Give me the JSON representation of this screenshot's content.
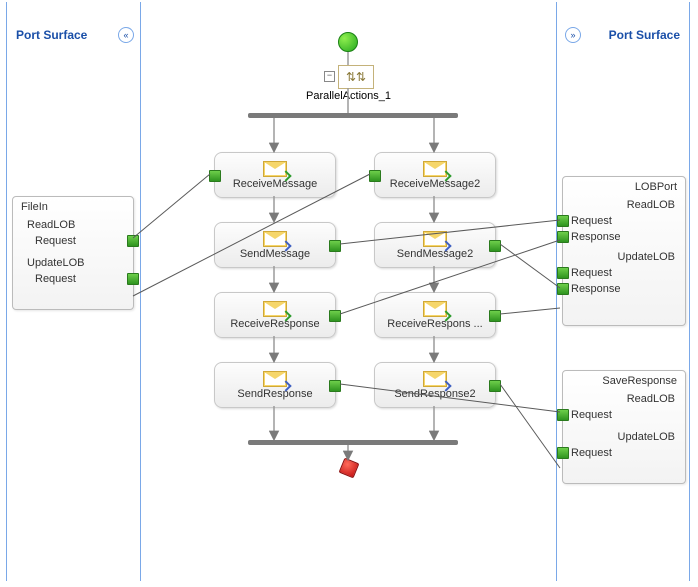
{
  "portSurface": {
    "leftLabel": "Port Surface",
    "rightLabel": "Port Surface"
  },
  "start": {
    "name": "start"
  },
  "end": {
    "name": "end"
  },
  "parallel": {
    "label": "ParallelActions_1",
    "expander": "−"
  },
  "actions": {
    "rm1": {
      "label": "ReceiveMessage",
      "kind": "receive"
    },
    "rm2": {
      "label": "ReceiveMessage2",
      "kind": "receive"
    },
    "sm1": {
      "label": "SendMessage",
      "kind": "send"
    },
    "sm2": {
      "label": "SendMessage2",
      "kind": "send"
    },
    "rr1": {
      "label": "ReceiveResponse",
      "kind": "receive"
    },
    "rr2": {
      "label": "ReceiveRespons ...",
      "kind": "receive"
    },
    "sr1": {
      "label": "SendResponse",
      "kind": "send"
    },
    "sr2": {
      "label": "SendResponse2",
      "kind": "send"
    }
  },
  "ports": {
    "fileIn": {
      "title": "FileIn",
      "ops": [
        {
          "name": "ReadLOB",
          "msgs": [
            "Request"
          ]
        },
        {
          "name": "UpdateLOB",
          "msgs": [
            "Request"
          ]
        }
      ]
    },
    "lobPort": {
      "title": "LOBPort",
      "ops": [
        {
          "name": "ReadLOB",
          "msgs": [
            "Request",
            "Response"
          ]
        },
        {
          "name": "UpdateLOB",
          "msgs": [
            "Request",
            "Response"
          ]
        }
      ]
    },
    "saveResponse": {
      "title": "SaveResponse",
      "ops": [
        {
          "name": "ReadLOB",
          "msgs": [
            "Request"
          ]
        },
        {
          "name": "UpdateLOB",
          "msgs": [
            "Request"
          ]
        }
      ]
    }
  },
  "collapse": {
    "left": "«",
    "right": "»"
  }
}
